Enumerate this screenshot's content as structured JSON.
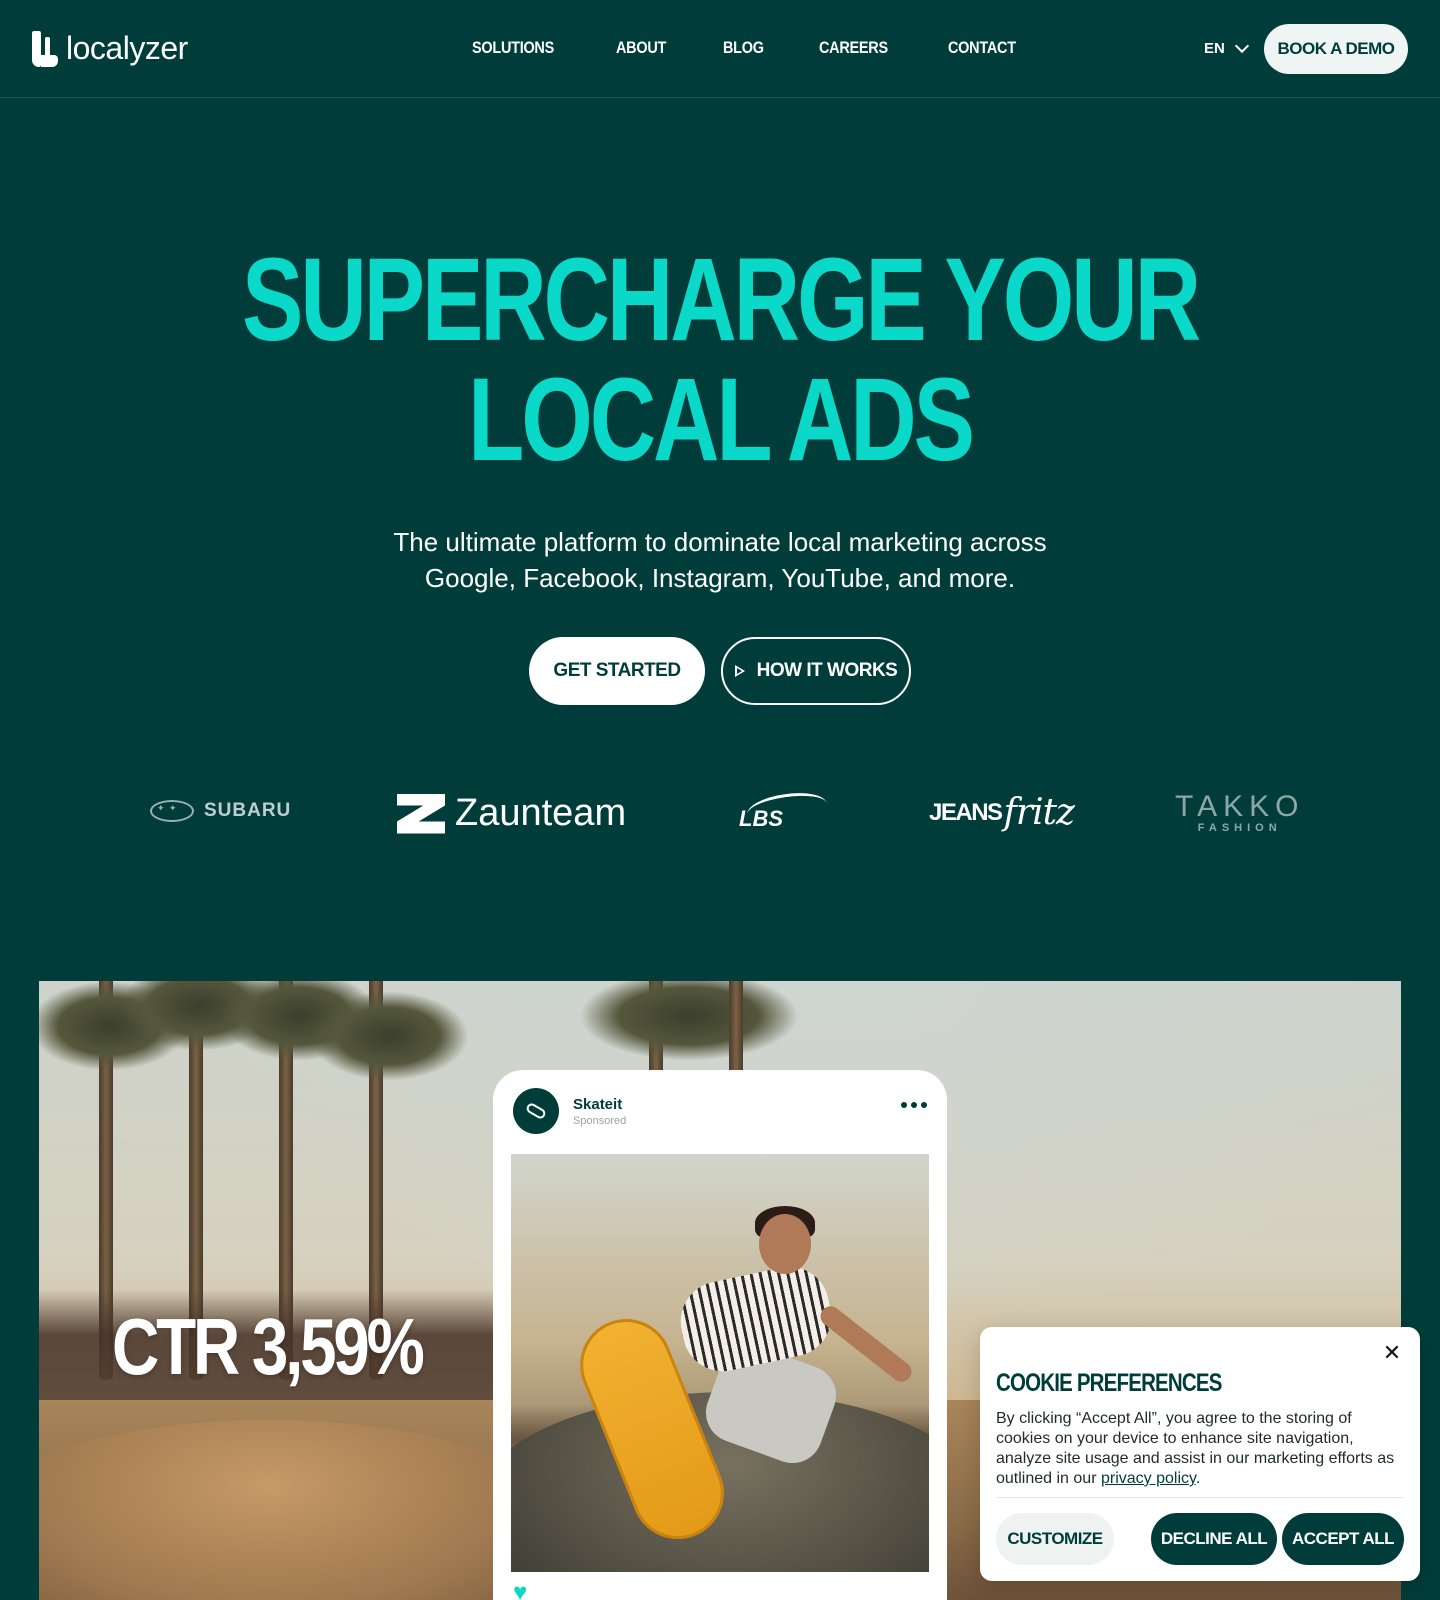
{
  "header": {
    "logo_text": "localyzer",
    "nav": [
      "SOLUTIONS",
      "ABOUT",
      "BLOG",
      "CAREERS",
      "CONTACT"
    ],
    "language": "EN",
    "demo_button": "BOOK A DEMO"
  },
  "hero": {
    "title_line1": "SUPERCHARGE YOUR",
    "title_line2": "LOCAL ADS",
    "subtitle_line1": "The ultimate platform to dominate local marketing across",
    "subtitle_line2": "Google, Facebook, Instagram, YouTube, and more.",
    "primary_button": "GET STARTED",
    "secondary_button": "HOW IT WORKS",
    "accent_color": "#0ad8c8"
  },
  "brands": {
    "subaru": "SUBARU",
    "zaunteam": "Zaunteam",
    "lbs": "LBS",
    "jeans": "JEANS",
    "fritz": "fritz",
    "takko": "TAKKO",
    "takko_sub": "FASHION"
  },
  "showcase": {
    "metric": "CTR 3,59%",
    "post": {
      "account": "Skateit",
      "label": "Sponsored"
    }
  },
  "cookie": {
    "title": "COOKIE PREFERENCES",
    "text_before_link": "By clicking “Accept All”, you agree to the storing of cookies on your device to enhance site navigation, analyze site usage and assist in our marketing efforts as outlined in our ",
    "link_text": "privacy policy",
    "text_after_link": ".",
    "customize": "CUSTOMIZE",
    "decline": "DECLINE ALL",
    "accept": "ACCEPT ALL"
  },
  "colors": {
    "background": "#003d3a",
    "accent": "#0ad8c8"
  }
}
